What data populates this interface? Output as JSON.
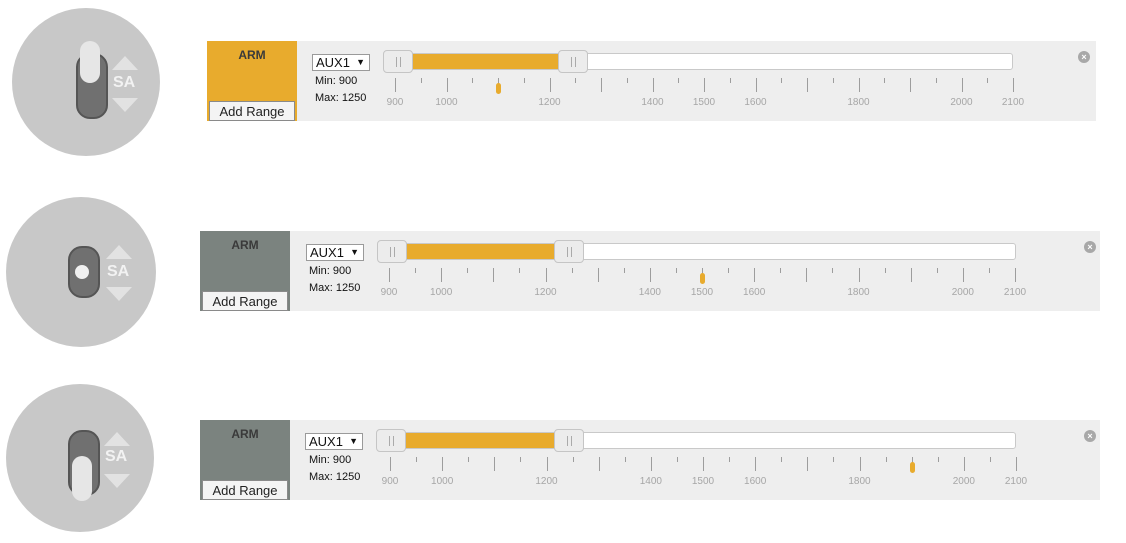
{
  "rows": [
    {
      "switch_position": "up",
      "switch_label": "SA",
      "mode": "ARM",
      "mode_active": true,
      "add_range_label": "Add Range",
      "channel": "AUX1",
      "min_label": "Min: 900",
      "max_label": "Max: 1250",
      "range_min": 900,
      "range_max": 1250,
      "current_value": 1100,
      "active_color": "#e8ab2d",
      "inactive_color": "#7b837f"
    },
    {
      "switch_position": "middle",
      "switch_label": "SA",
      "mode": "ARM",
      "mode_active": false,
      "add_range_label": "Add Range",
      "channel": "AUX1",
      "min_label": "Min: 900",
      "max_label": "Max: 1250",
      "range_min": 900,
      "range_max": 1250,
      "current_value": 1500
    },
    {
      "switch_position": "down",
      "switch_label": "SA",
      "mode": "ARM",
      "mode_active": false,
      "add_range_label": "Add Range",
      "channel": "AUX1",
      "min_label": "Min: 900",
      "max_label": "Max: 1250",
      "range_min": 900,
      "range_max": 1250,
      "current_value": 1900
    }
  ],
  "scale": {
    "min": 900,
    "max": 2100,
    "labels": [
      "900",
      "1000",
      "1200",
      "1400",
      "1500",
      "1600",
      "1800",
      "2000",
      "2100"
    ]
  }
}
